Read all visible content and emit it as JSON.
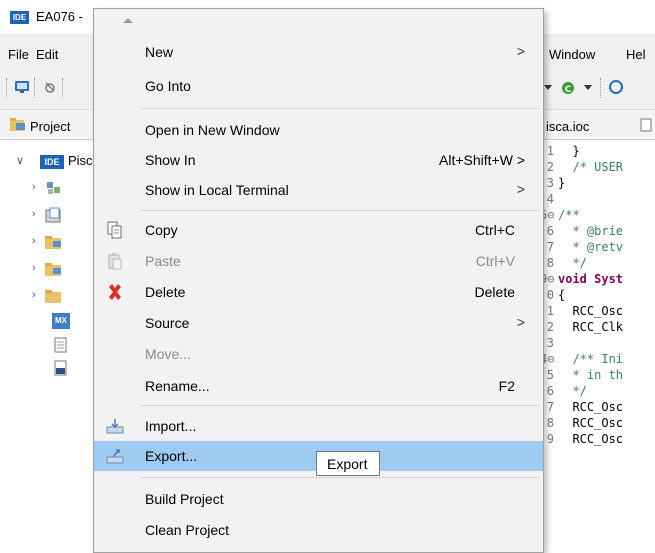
{
  "window": {
    "title": "EA076 -",
    "badge": "IDE"
  },
  "menubar": {
    "file": "File",
    "edit": "Edit",
    "window": "Window",
    "help": "Hel"
  },
  "left_pane": {
    "tab_label": "Project",
    "root_label": "Pisc",
    "root_badge": "IDE",
    "mx_badge": "MX"
  },
  "editor": {
    "tab_label": "isca.ioc",
    "lines": [
      {
        "num": "1",
        "text": "  }"
      },
      {
        "num": "2",
        "text": "  /* USER"
      },
      {
        "num": "3",
        "text": "}"
      },
      {
        "num": "4",
        "text": ""
      },
      {
        "num": "5⊖",
        "text": "/**"
      },
      {
        "num": "6",
        "text": "  * @brie"
      },
      {
        "num": "7",
        "text": "  * @retv"
      },
      {
        "num": "8",
        "text": "  */"
      },
      {
        "num": "9⊖",
        "text": "void Syst"
      },
      {
        "num": "0",
        "text": "{"
      },
      {
        "num": "1",
        "text": "  RCC_Osc"
      },
      {
        "num": "2",
        "text": "  RCC_Clk"
      },
      {
        "num": "3",
        "text": ""
      },
      {
        "num": "4⊖",
        "text": "  /** Ini"
      },
      {
        "num": "5",
        "text": "  * in th"
      },
      {
        "num": "6",
        "text": "  */"
      },
      {
        "num": "7",
        "text": "  RCC_Osc"
      },
      {
        "num": "8",
        "text": "  RCC_Osc"
      },
      {
        "num": "9",
        "text": "  RCC_Osc"
      }
    ]
  },
  "context_menu": {
    "items": [
      {
        "label": "New",
        "submenu": ">",
        "accel": ""
      },
      {
        "label": "Go Into",
        "accel": ""
      },
      {
        "label": "Open in New Window",
        "accel": ""
      },
      {
        "label": "Show In",
        "accel": "Alt+Shift+W >"
      },
      {
        "label": "Show in Local Terminal",
        "submenu": ">"
      },
      {
        "label": "Copy",
        "accel": "Ctrl+C",
        "icon": "copy-icon"
      },
      {
        "label": "Paste",
        "accel": "Ctrl+V",
        "icon": "paste-icon",
        "disabled": true
      },
      {
        "label": "Delete",
        "accel": "Delete",
        "icon": "delete-icon"
      },
      {
        "label": "Source",
        "submenu": ">"
      },
      {
        "label": "Move...",
        "disabled": true
      },
      {
        "label": "Rename...",
        "accel": "F2"
      },
      {
        "label": "Import...",
        "icon": "import-icon"
      },
      {
        "label": "Export...",
        "icon": "export-icon",
        "hovered": true
      },
      {
        "label": "Build Project"
      },
      {
        "label": "Clean Project"
      }
    ],
    "tooltip": "Export"
  },
  "colors": {
    "hover": "#9fcbf2",
    "menu_bg": "#f2f2f2",
    "ide_blue": "#1e63b4",
    "delete_red": "#d9302c"
  }
}
